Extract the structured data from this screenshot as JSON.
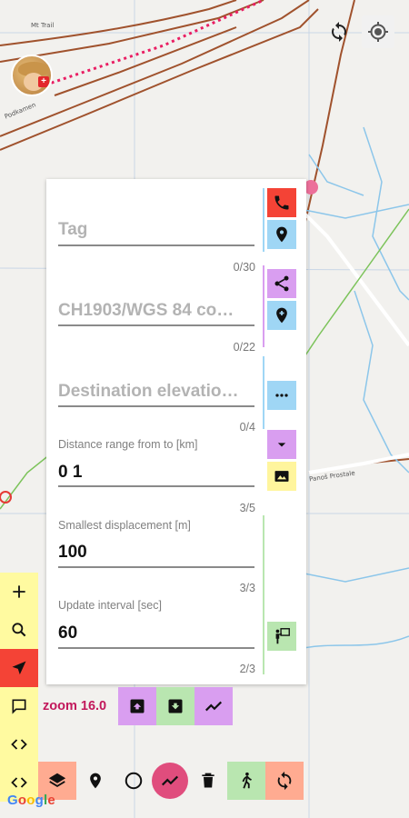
{
  "map": {
    "labels": [
      "Mt Trail",
      "Podkamen",
      "Panoš Prostale"
    ],
    "attribution": "Google"
  },
  "top_buttons": [
    {
      "name": "refresh",
      "icon": "refresh-icon"
    },
    {
      "name": "my-location",
      "icon": "gps-fixed-icon"
    }
  ],
  "form": {
    "tag": {
      "placeholder": "Tag",
      "counter": "0/30"
    },
    "coords": {
      "placeholder": "CH1903/WGS 84 co…",
      "counter": "0/22"
    },
    "elevation": {
      "placeholder": "Destination elevatio…",
      "counter": "0/4"
    },
    "distance": {
      "label": "Distance range from to [km]",
      "value": "0 1",
      "counter": "3/5"
    },
    "displacement": {
      "label": "Smallest displacement [m]",
      "value": "100",
      "counter": "3/3"
    },
    "interval": {
      "label": "Update interval [sec]",
      "value": "60",
      "counter": "2/3"
    }
  },
  "side_buttons": [
    {
      "icon": "phone-icon",
      "color": "#f44336"
    },
    {
      "icon": "place-icon",
      "color": "#9fd6f5"
    },
    {
      "icon": "share-icon",
      "color": "#d99ef0"
    },
    {
      "icon": "add-location-icon",
      "color": "#9fd6f5"
    },
    {
      "icon": "more-horiz-icon",
      "color": "#9fd6f5"
    },
    {
      "icon": "arrow-drop-down-icon",
      "color": "#d99ef0"
    },
    {
      "icon": "image-icon",
      "color": "#fff59d"
    },
    {
      "icon": "guide-icon",
      "color": "#b9e6b0"
    }
  ],
  "left_toolbar": [
    {
      "icon": "plus-icon",
      "color": "#fffaa0"
    },
    {
      "icon": "search-icon",
      "color": "#fffaa0"
    },
    {
      "icon": "navigation-arrow-icon",
      "color": "#f44336"
    },
    {
      "icon": "comment-icon",
      "color": "#fffaa0"
    },
    {
      "icon": "code-icon",
      "color": "#fffaa0"
    },
    {
      "icon": "code-icon",
      "color": "#fffaa0"
    }
  ],
  "zoom_label": "zoom 16.0",
  "zoom_row_buttons": [
    {
      "icon": "upload-box-icon",
      "color": "#d99ef0"
    },
    {
      "icon": "download-box-icon",
      "color": "#b9e6b0"
    },
    {
      "icon": "trending-up-icon",
      "color": "#d99ef0"
    }
  ],
  "bottom_toolbar": [
    {
      "icon": "layers-icon",
      "color": "#ffab91"
    },
    {
      "icon": "place-icon",
      "color": "transparent"
    },
    {
      "icon": "circle-icon",
      "color": "transparent"
    },
    {
      "icon": "trending-up-icon",
      "color": "#e04d7d"
    },
    {
      "icon": "delete-icon",
      "color": "transparent"
    },
    {
      "icon": "walk-icon",
      "color": "#b9e6b0"
    },
    {
      "icon": "sync-icon",
      "color": "#ffab91"
    }
  ]
}
